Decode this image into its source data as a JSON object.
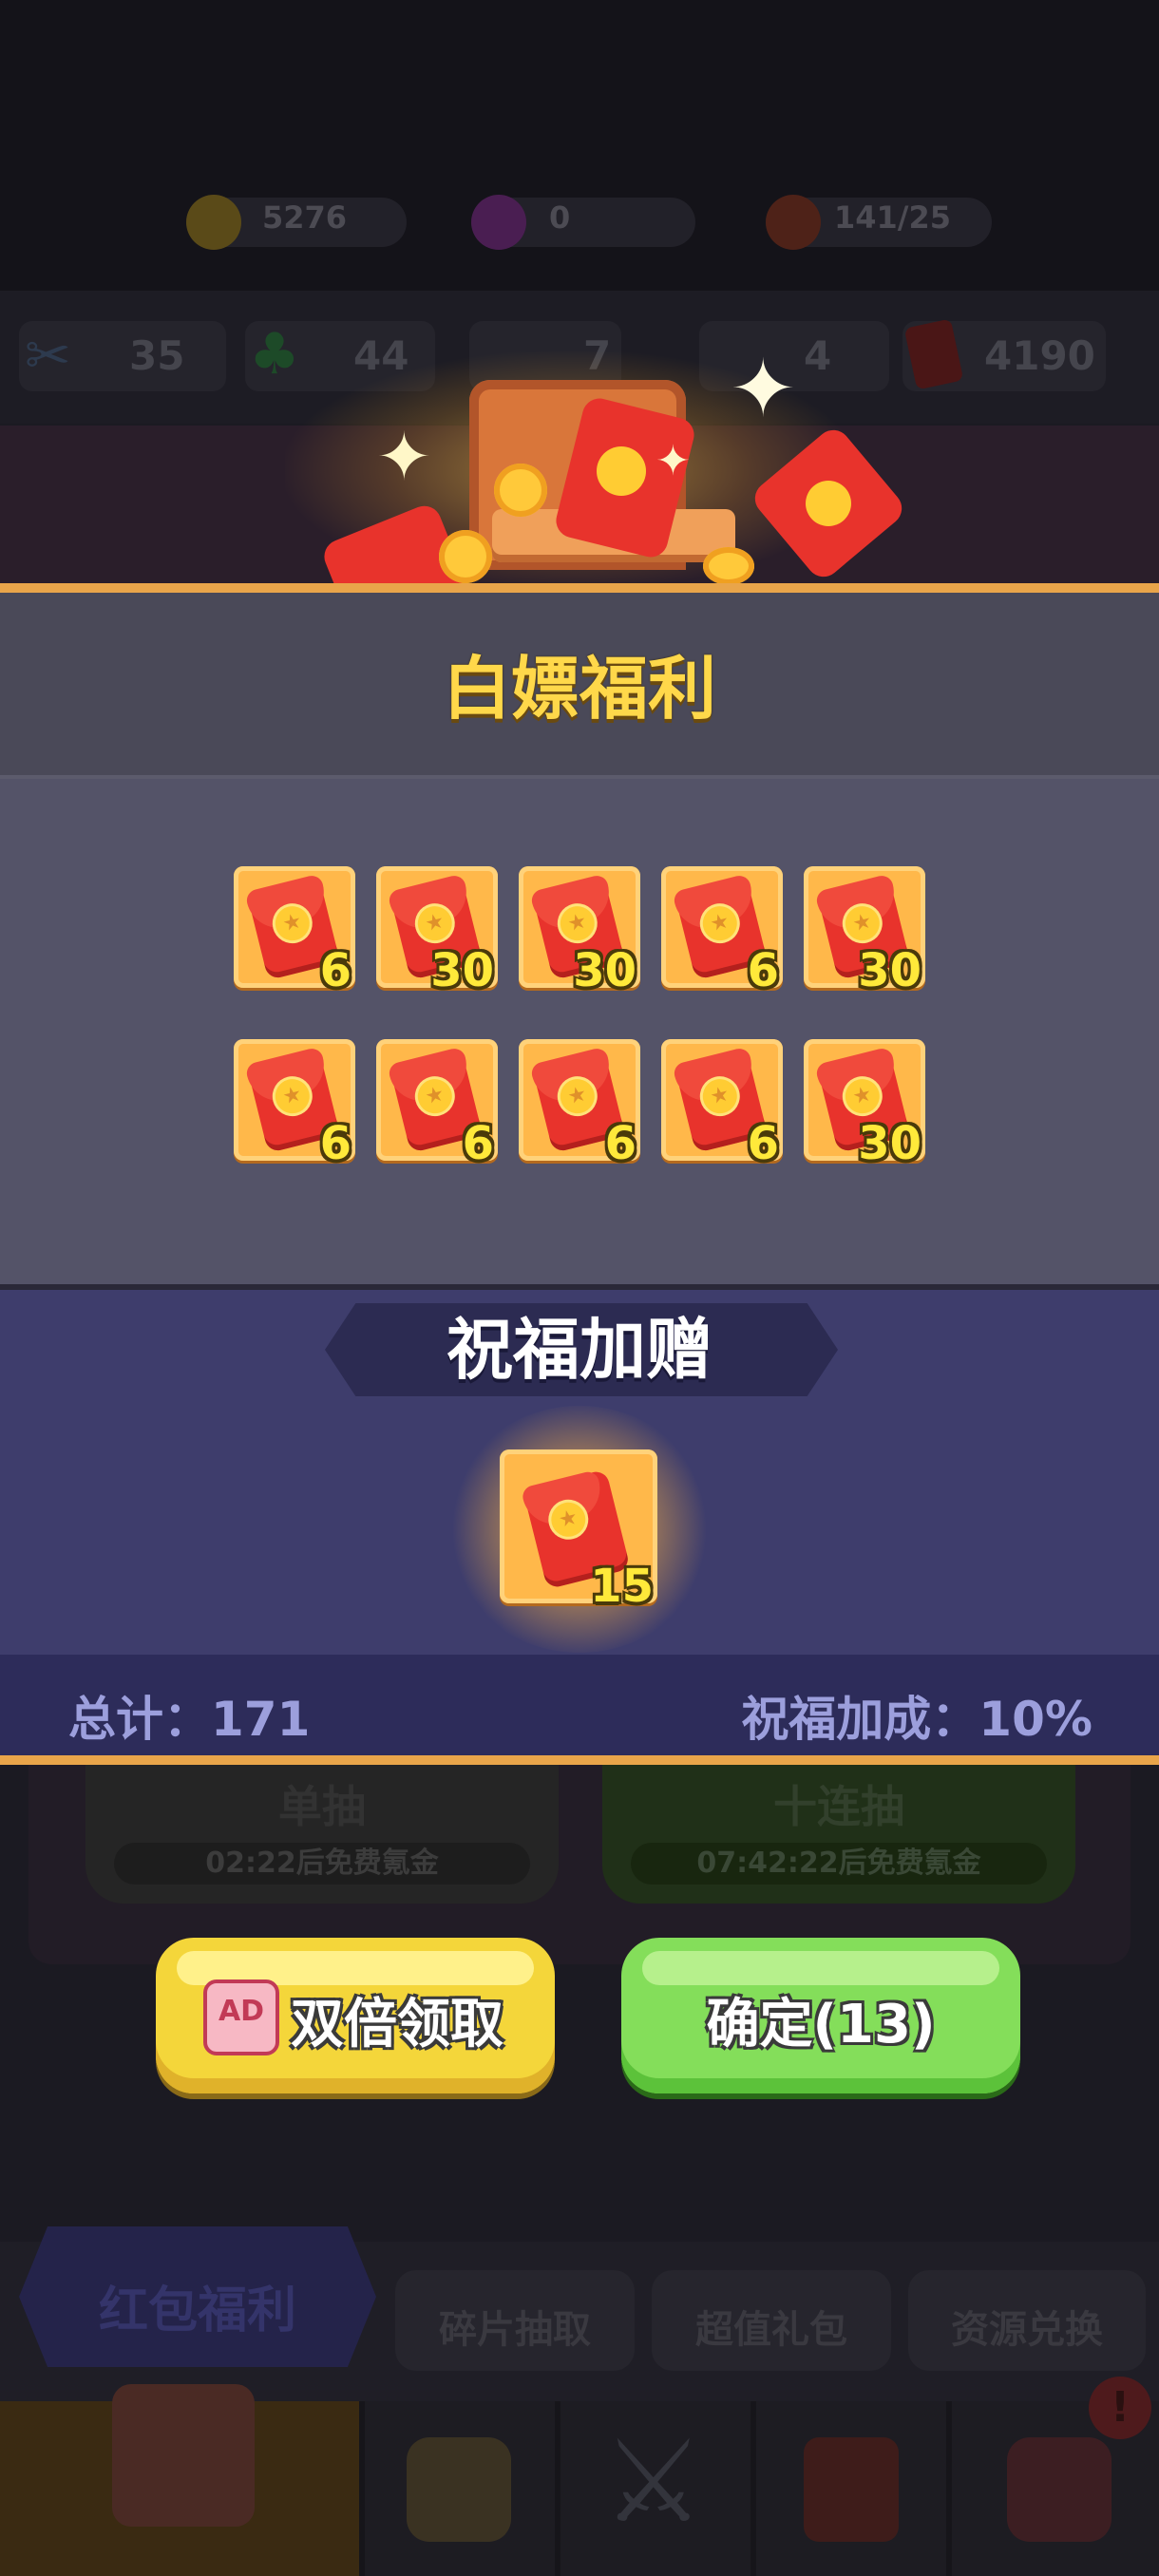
{
  "resources": [
    {
      "icon": "coin-icon",
      "value": "5276",
      "color": "#f5c02a"
    },
    {
      "icon": "gem-icon",
      "value": "0",
      "color": "#b93adc"
    },
    {
      "icon": "meat-icon",
      "value": "141/25",
      "color": "#e2543a"
    }
  ],
  "stats": [
    {
      "icon": "scissors-icon",
      "value": "35"
    },
    {
      "icon": "clover-icon",
      "value": "44"
    },
    {
      "icon": "potion-icon",
      "value": "7"
    },
    {
      "icon": "flask-icon",
      "value": "4"
    },
    {
      "icon": "red-envelope-icon",
      "value": "4190"
    }
  ],
  "popup": {
    "title": "白嫖福利",
    "rewards": [
      {
        "amount": "6"
      },
      {
        "amount": "30"
      },
      {
        "amount": "30"
      },
      {
        "amount": "6"
      },
      {
        "amount": "30"
      },
      {
        "amount": "6"
      },
      {
        "amount": "6"
      },
      {
        "amount": "6"
      },
      {
        "amount": "6"
      },
      {
        "amount": "30"
      }
    ],
    "bless_title": "祝福加赠",
    "bless_reward": {
      "amount": "15"
    },
    "total_label": "总计：171",
    "bonus_label": "祝福加成：10%"
  },
  "draw": {
    "single_title": "单抽",
    "single_sub": "02:22后免费氪金",
    "ten_title": "十连抽",
    "ten_sub": "07:42:22后免费氪金"
  },
  "buttons": {
    "ad_badge": "AD",
    "double_label": "双倍领取",
    "confirm_label": "确定(13)"
  },
  "tabs": {
    "main": "红包福利",
    "items": [
      "碎片抽取",
      "超值礼包",
      "资源兑换"
    ]
  },
  "nav": [
    "shop-icon",
    "backpack-icon",
    "battle-icon",
    "book-icon",
    "hero-icon"
  ],
  "colors": {
    "accent_gold": "#ffd84a",
    "border_orange": "#e9a54a",
    "confirm_green": "#84de5a",
    "double_yellow": "#f4d63a"
  }
}
